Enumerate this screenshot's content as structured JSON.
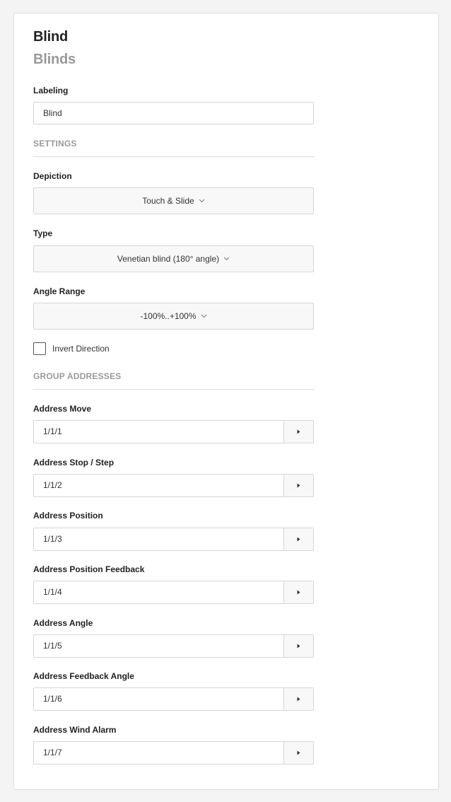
{
  "header": {
    "title": "Blind",
    "subtitle": "Blinds"
  },
  "labeling": {
    "label": "Labeling",
    "value": "Blind"
  },
  "settings": {
    "section_label": "SETTINGS",
    "depiction": {
      "label": "Depiction",
      "value": "Touch & Slide"
    },
    "type": {
      "label": "Type",
      "value": "Venetian blind (180° angle)"
    },
    "angle_range": {
      "label": "Angle Range",
      "value": "-100%..+100%"
    },
    "invert_direction": {
      "label": "Invert Direction",
      "checked": false
    }
  },
  "group_addresses": {
    "section_label": "GROUP ADDRESSES",
    "items": [
      {
        "label": "Address Move",
        "value": "1/1/1"
      },
      {
        "label": "Address Stop / Step",
        "value": "1/1/2"
      },
      {
        "label": "Address Position",
        "value": "1/1/3"
      },
      {
        "label": "Address Position Feedback",
        "value": "1/1/4"
      },
      {
        "label": "Address Angle",
        "value": "1/1/5"
      },
      {
        "label": "Address Feedback Angle",
        "value": "1/1/6"
      },
      {
        "label": "Address Wind Alarm",
        "value": "1/1/7"
      }
    ]
  },
  "icons": {
    "select_chevron": "chevron-down-icon",
    "address_button": "caret-right-icon"
  }
}
